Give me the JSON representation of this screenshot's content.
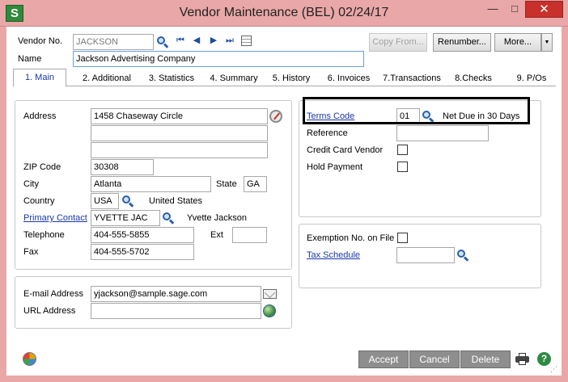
{
  "window": {
    "title": "Vendor Maintenance (BEL) 02/24/17",
    "app_icon": "S",
    "min": "—",
    "max": "□",
    "close": "✕"
  },
  "header": {
    "vendor_no_label": "Vendor No.",
    "vendor_no": "JACKSON",
    "name_label": "Name",
    "name": "Jackson Advertising Company",
    "copy_from": "Copy From...",
    "renumber": "Renumber...",
    "more": "More...",
    "more_arrow": "▼"
  },
  "tabs": [
    {
      "label": "1. Main"
    },
    {
      "label": "2. Additional"
    },
    {
      "label": "3. Statistics"
    },
    {
      "label": "4. Summary"
    },
    {
      "label": "5. History"
    },
    {
      "label": "6. Invoices"
    },
    {
      "label": "7.Transactions"
    },
    {
      "label": "8.Checks"
    },
    {
      "label": "9. P/Os"
    }
  ],
  "address": {
    "address_label": "Address",
    "line1": "1458 Chaseway Circle",
    "line2": "",
    "line3": "",
    "zip_label": "ZIP Code",
    "zip": "30308",
    "city_label": "City",
    "city": "Atlanta",
    "state_label": "State",
    "state": "GA",
    "country_label": "Country",
    "country": "USA",
    "country_name": "United States",
    "contact_label": "Primary Contact",
    "contact": "YVETTE JAC",
    "contact_name": "Yvette Jackson",
    "telephone_label": "Telephone",
    "telephone": "404-555-5855",
    "ext_label": "Ext",
    "ext": "",
    "fax_label": "Fax",
    "fax": "404-555-5702"
  },
  "email": {
    "email_label": "E-mail Address",
    "email": "yjackson@sample.sage.com",
    "url_label": "URL Address",
    "url": ""
  },
  "terms": {
    "terms_label": "Terms Code",
    "terms_code": "01",
    "terms_desc": "Net Due in 30 Days",
    "reference_label": "Reference",
    "reference": "",
    "credit_card_label": "Credit Card Vendor",
    "hold_payment_label": "Hold Payment"
  },
  "tax": {
    "exemption_label": "Exemption No. on File",
    "schedule_label": "Tax Schedule",
    "schedule": ""
  },
  "footer": {
    "accept": "Accept",
    "cancel": "Cancel",
    "delete": "Delete",
    "help": "?"
  },
  "colors": {
    "titlebar": "#e9a7a7",
    "link": "#1a37a8",
    "close": "#c7302b",
    "highlight": "#000000"
  }
}
